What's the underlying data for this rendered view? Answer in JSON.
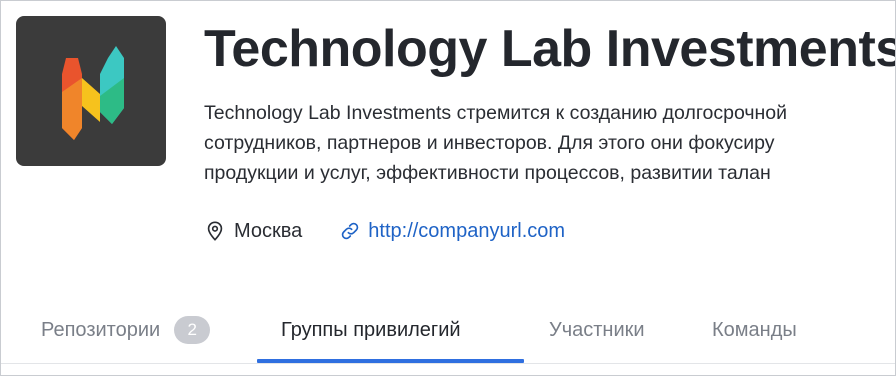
{
  "org": {
    "title": "Technology Lab Investments",
    "description_lines": [
      "Technology Lab Investments стремится к созданию долгосрочной",
      "сотрудников, партнеров и инвесторов. Для этого они фокусиру",
      "продукции и услуг, эффективности процессов, развитии талан"
    ],
    "location": "Москва",
    "url": "http://companyurl.com",
    "logo_icon": "n-logo-icon",
    "logo_colors": [
      "#f0852a",
      "#f6c21d",
      "#3cc8c2",
      "#e9542d",
      "#2dbb86"
    ]
  },
  "tabs": {
    "repositories": {
      "label": "Репозитории",
      "count": "2"
    },
    "privilege_groups": {
      "label": "Группы привилегий"
    },
    "members": {
      "label": "Участники"
    },
    "teams": {
      "label": "Команды"
    }
  },
  "active_tab": "privilege_groups",
  "colors": {
    "accent": "#2f6fe0",
    "link": "#1f63c6",
    "logo_bg": "#3b3b3b",
    "badge_bg": "#c9cbd1"
  }
}
